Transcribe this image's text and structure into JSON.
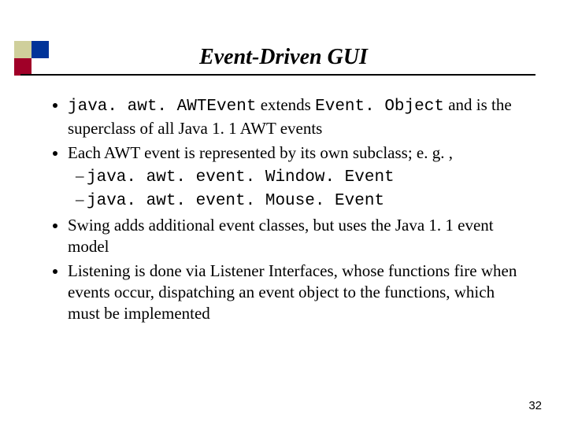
{
  "title": "Event-Driven GUI",
  "bullets": {
    "b0": {
      "seg0": "java. awt. AWTEvent",
      "seg1": " extends ",
      "seg2": "Event. Object",
      "seg3": " and is the superclass of all Java 1. 1 AWT events"
    },
    "b1": {
      "text": "Each AWT event is represented by its own subclass; e. g. ,",
      "sub0": "java. awt. event. Window. Event",
      "sub1": "java. awt. event. Mouse. Event"
    },
    "b2": "Swing adds additional event classes, but uses the Java 1. 1 event model",
    "b3": "Listening is done via Listener Interfaces, whose functions fire when events occur, dispatching an event object to the functions, which must be implemented"
  },
  "page_number": "32"
}
